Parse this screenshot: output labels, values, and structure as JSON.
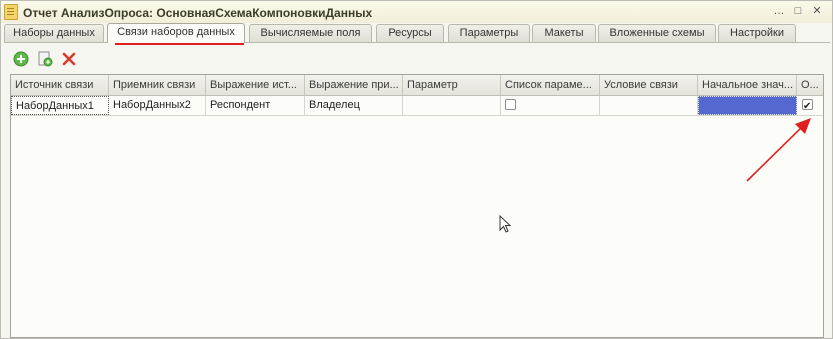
{
  "window": {
    "title": "Отчет АнализОпроса: ОсновнаяСхемаКомпоновкиДанных",
    "controls": [
      "…",
      "□",
      "✕"
    ],
    "app_icon": "document-icon"
  },
  "tabs": [
    {
      "label": "Наборы данных",
      "active": false
    },
    {
      "label": "Связи наборов данных",
      "active": true
    },
    {
      "label": "Вычисляемые поля",
      "active": false
    },
    {
      "label": "Ресурсы",
      "active": false
    },
    {
      "label": "Параметры",
      "active": false
    },
    {
      "label": "Макеты",
      "active": false
    },
    {
      "label": "Вложенные схемы",
      "active": false
    },
    {
      "label": "Настройки",
      "active": false
    }
  ],
  "toolbar": {
    "add_icon": "add-icon",
    "copy_icon": "copy-icon",
    "delete_icon": "delete-icon"
  },
  "grid": {
    "columns": [
      "Источник связи",
      "Приемник связи",
      "Выражение ист...",
      "Выражение при...",
      "Параметр",
      "Список параме...",
      "Условие связи",
      "Начальное знач...",
      "О..."
    ],
    "rows": [
      {
        "source": "НаборДанных1",
        "target": "НаборДанных2",
        "source_expr": "Респондент",
        "target_expr": "Владелец",
        "parameter": "",
        "param_list_checked": false,
        "condition": "",
        "initial_value": "",
        "required_checked": true
      }
    ]
  },
  "colors": {
    "accent_selection": "#5468cf",
    "annotation_red": "#e02020"
  }
}
